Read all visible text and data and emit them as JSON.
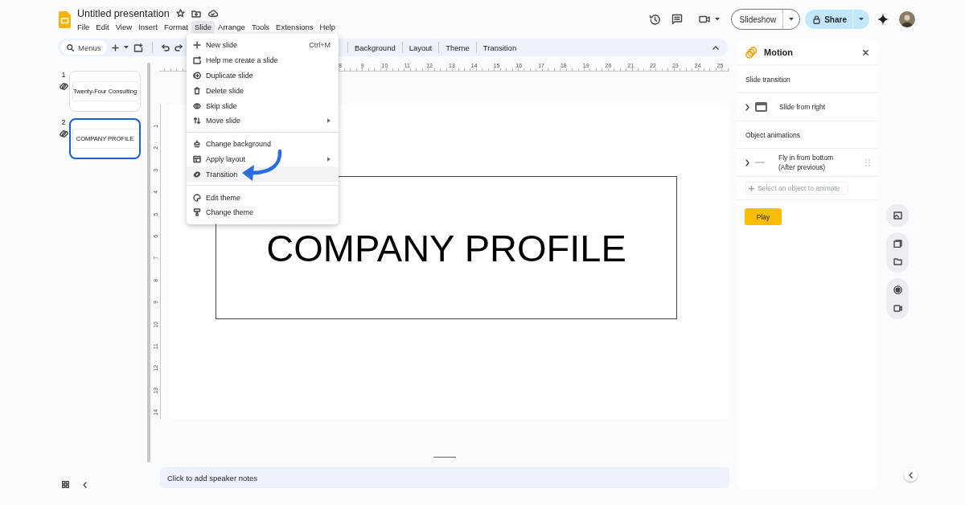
{
  "document": {
    "title": "Untitled presentation"
  },
  "menu_bar": [
    {
      "label": "File",
      "selected": false
    },
    {
      "label": "Edit",
      "selected": false
    },
    {
      "label": "View",
      "selected": false
    },
    {
      "label": "Insert",
      "selected": false
    },
    {
      "label": "Format",
      "selected": false
    },
    {
      "label": "Slide",
      "selected": true
    },
    {
      "label": "Arrange",
      "selected": false
    },
    {
      "label": "Tools",
      "selected": false
    },
    {
      "label": "Extensions",
      "selected": false
    },
    {
      "label": "Help",
      "selected": false
    }
  ],
  "header_buttons": {
    "slideshow": "Slideshow",
    "share": "Share"
  },
  "toolbar": {
    "search_placeholder": "Menus",
    "buttons": [
      "Background",
      "Layout",
      "Theme",
      "Transition"
    ]
  },
  "rulers": {
    "horizontal": [
      "8",
      "9",
      "10",
      "11",
      "12",
      "13",
      "14",
      "15",
      "16",
      "17",
      "18",
      "19",
      "20",
      "21",
      "22",
      "23",
      "24",
      "25"
    ],
    "vertical": [
      "1",
      "2",
      "3",
      "4",
      "5",
      "6",
      "7",
      "8",
      "9",
      "10",
      "11",
      "12",
      "13",
      "14"
    ]
  },
  "slides": [
    {
      "number": "1",
      "text": "Twenty-Four Consulting",
      "selected": false
    },
    {
      "number": "2",
      "text": "COMPANY PROFILE",
      "selected": true
    }
  ],
  "slide": {
    "title": "COMPANY PROFILE"
  },
  "speaker_notes": {
    "placeholder": "Click to add speaker notes"
  },
  "slide_menu": {
    "groups": [
      [
        {
          "label": "New slide",
          "shortcut": "Ctrl+M",
          "submenu": false,
          "highlighted": false
        },
        {
          "label": "Help me create a slide",
          "submenu": false,
          "highlighted": false
        },
        {
          "label": "Duplicate slide",
          "submenu": false,
          "highlighted": false
        },
        {
          "label": "Delete slide",
          "submenu": false,
          "highlighted": false
        },
        {
          "label": "Skip slide",
          "submenu": false,
          "highlighted": false
        },
        {
          "label": "Move slide",
          "submenu": true,
          "highlighted": false
        }
      ],
      [
        {
          "label": "Change background",
          "submenu": false,
          "highlighted": false
        },
        {
          "label": "Apply layout",
          "submenu": true,
          "highlighted": false
        },
        {
          "label": "Transition",
          "submenu": false,
          "highlighted": true
        }
      ],
      [
        {
          "label": "Edit theme",
          "submenu": false,
          "highlighted": false
        },
        {
          "label": "Change theme",
          "submenu": false,
          "highlighted": false
        }
      ]
    ]
  },
  "motion_panel": {
    "title": "Motion",
    "slide_transition": {
      "heading": "Slide transition",
      "effect": "Slide from right"
    },
    "object_animations": {
      "heading": "Object animations",
      "items": [
        {
          "effect": "Fly in from bottom",
          "timing": "(After previous)"
        }
      ],
      "add_placeholder": "Select an object to animate"
    },
    "play": "Play"
  }
}
